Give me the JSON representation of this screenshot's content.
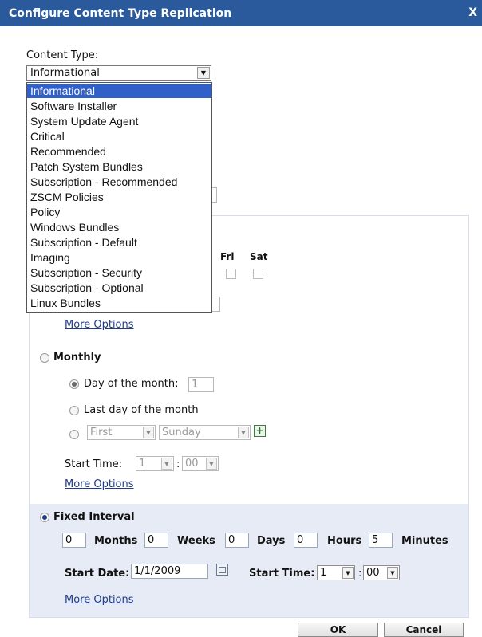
{
  "window": {
    "title": "Configure Content Type Replication",
    "close_glyph": "X"
  },
  "content_type": {
    "label": "Content Type:",
    "selected": "Informational",
    "options": [
      "Informational",
      "Software Installer",
      "System Update Agent",
      "Critical",
      "Recommended",
      "Patch System Bundles",
      "Subscription - Recommended",
      "ZSCM Policies",
      "Policy",
      "Windows Bundles",
      "Subscription - Default",
      "Imaging",
      "Subscription - Security",
      "Subscription - Optional",
      "Linux Bundles"
    ]
  },
  "weekly": {
    "day_headers": [
      "Fri",
      "Sat"
    ],
    "more_options": "More Options"
  },
  "monthly": {
    "label": "Monthly",
    "day_of_month_label": "Day of the month:",
    "day_of_month_value": "1",
    "last_day_label": "Last day of the month",
    "first_select": "First",
    "weekday_select": "Sunday",
    "start_time_label": "Start Time:",
    "hour_value": "1",
    "colon": ":",
    "minute_value": "00",
    "more_options": "More Options"
  },
  "fixed_interval": {
    "label": "Fixed Interval",
    "months_value": "0",
    "months_label": "Months",
    "weeks_value": "0",
    "weeks_label": "Weeks",
    "days_value": "0",
    "days_label": "Days",
    "hours_value": "0",
    "hours_label": "Hours",
    "minutes_value": "5",
    "minutes_label": "Minutes",
    "start_date_label": "Start Date:",
    "start_date_value": "1/1/2009",
    "start_time_label": "Start Time:",
    "hour_value": "1",
    "colon": ":",
    "minute_value": "00",
    "more_options": "More Options"
  },
  "footer": {
    "ok": "OK",
    "cancel": "Cancel"
  }
}
